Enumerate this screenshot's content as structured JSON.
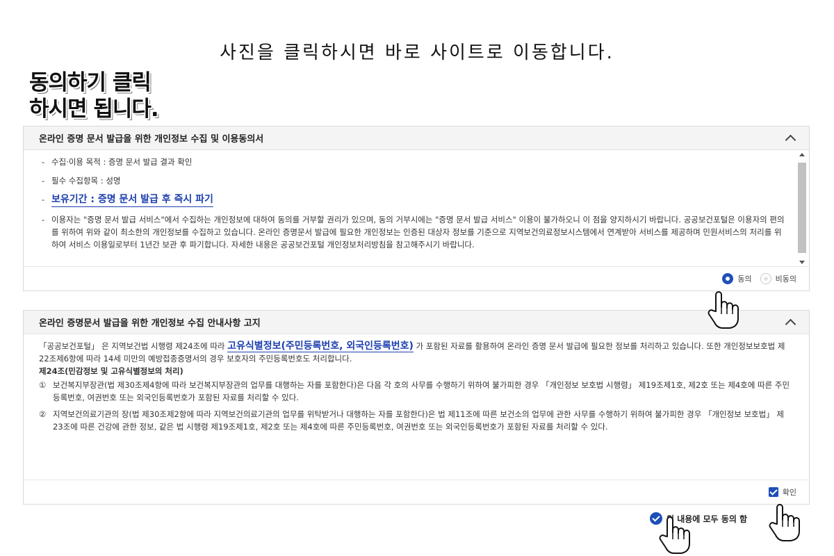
{
  "captions": {
    "top": "사진을 클릭하시면 바로 사이트로 이동합니다.",
    "side_line1": "동의하기 클릭",
    "side_line2": "하시면 됩니다."
  },
  "consent_panel": {
    "title": "온라인 증명 문서 발급을 위한 개인정보 수집 및 이용동의서",
    "items": {
      "purpose": "수집·이용 목적 : 증명 문서 발급 결과 확인",
      "fields": "필수 수집항목 : 성명",
      "retention": "보유기간 : 증명 문서 발급 후 즉시 파기",
      "notice": "이용자는 \"증명 문서 발급 서비스\"에서 수집하는 개인정보에 대하여 동의를 거부할 권리가 있으며, 동의 거부시에는 \"증명 문서 발급 서비스\" 이용이 불가하오니 이 점을 양지하시기 바랍니다. 공공보건포털은 이용자의 편의를 위하여 위와 같이 최소한의 개인정보를 수집하고 있습니다. 온라인 증명문서 발급에 필요한 개인정보는 인증된 대상자 정보를 기준으로 지역보건의료정보시스템에서 연계받아 서비스를 제공하며 민원서비스의 처리를 위하여 서비스 이용일로부터 1년간 보관 후 파기합니다. 자세한 내용은 공공보건포털 개인정보처리방침을 참고해주시기 바랍니다."
    },
    "dash": "-",
    "agree_label": "동의",
    "disagree_label": "비동의",
    "selected": "동의"
  },
  "notice_panel": {
    "title": "온라인 증명문서 발급을 위한 개인정보 수집 안내사항 고지",
    "intro_a": "「공공보건포털」 은 지역보건법 시행령 제24조에 따라",
    "intro_emph": "고유식별정보(주민등록번호, 외국인등록번호)",
    "intro_b": "가 포함된 자료를 활용하여 온라인 증명 문서 발급에 필요한 정보를 처리하고 있습니다. 또한 개인정보보호법 제22조제6항에 따라 14세 미만의 예방접종증명서의 경우 보호자의 주민등록번호도 처리합니다.",
    "article_title": "제24조(민감정보 및 고유식별정보의 처리)",
    "clauses": [
      {
        "num": "①",
        "text": "보건복지부장관(법 제30조제4항에 따라 보건복지부장관의 업무를 대행하는 자를 포함한다)은 다음 각 호의 사무를 수행하기 위하여 불가피한 경우 「개인정보 보호법 시행령」 제19조제1호, 제2호 또는 제4호에 따른 주민등록번호, 여권번호 또는 외국인등록번호가 포함된 자료를 처리할 수 있다."
      },
      {
        "num": "②",
        "text": "지역보건의료기관의 장(법 제30조제2항에 따라 지역보건의료기관의 업무를 위탁받거나 대행하는 자를 포함한다)은 법 제11조에 따른 보건소의 업무에 관한 사무를 수행하기 위하여 불가피한 경우 「개인정보 보호법」 제23조에 따른 건강에 관한 정보, 같은 법 시행령 제19조제1호, 제2호 또는 제4호에 따른 주민등록번호, 여권번호 또는 외국인등록번호가 포함된 자료를 처리할 수 있다."
      }
    ],
    "confirm_label": "확인",
    "confirmed": true
  },
  "agree_all_label": "위 내용에 모두 동의 함",
  "colors": {
    "accent": "#1d4fb8",
    "emphasis_text": "#1c3fae",
    "panel_header_bg": "#f4f4f4",
    "border": "#d9d9d9"
  },
  "icons": {
    "collapse": "chevron-up-icon",
    "pointer": "hand-pointer-icon"
  }
}
